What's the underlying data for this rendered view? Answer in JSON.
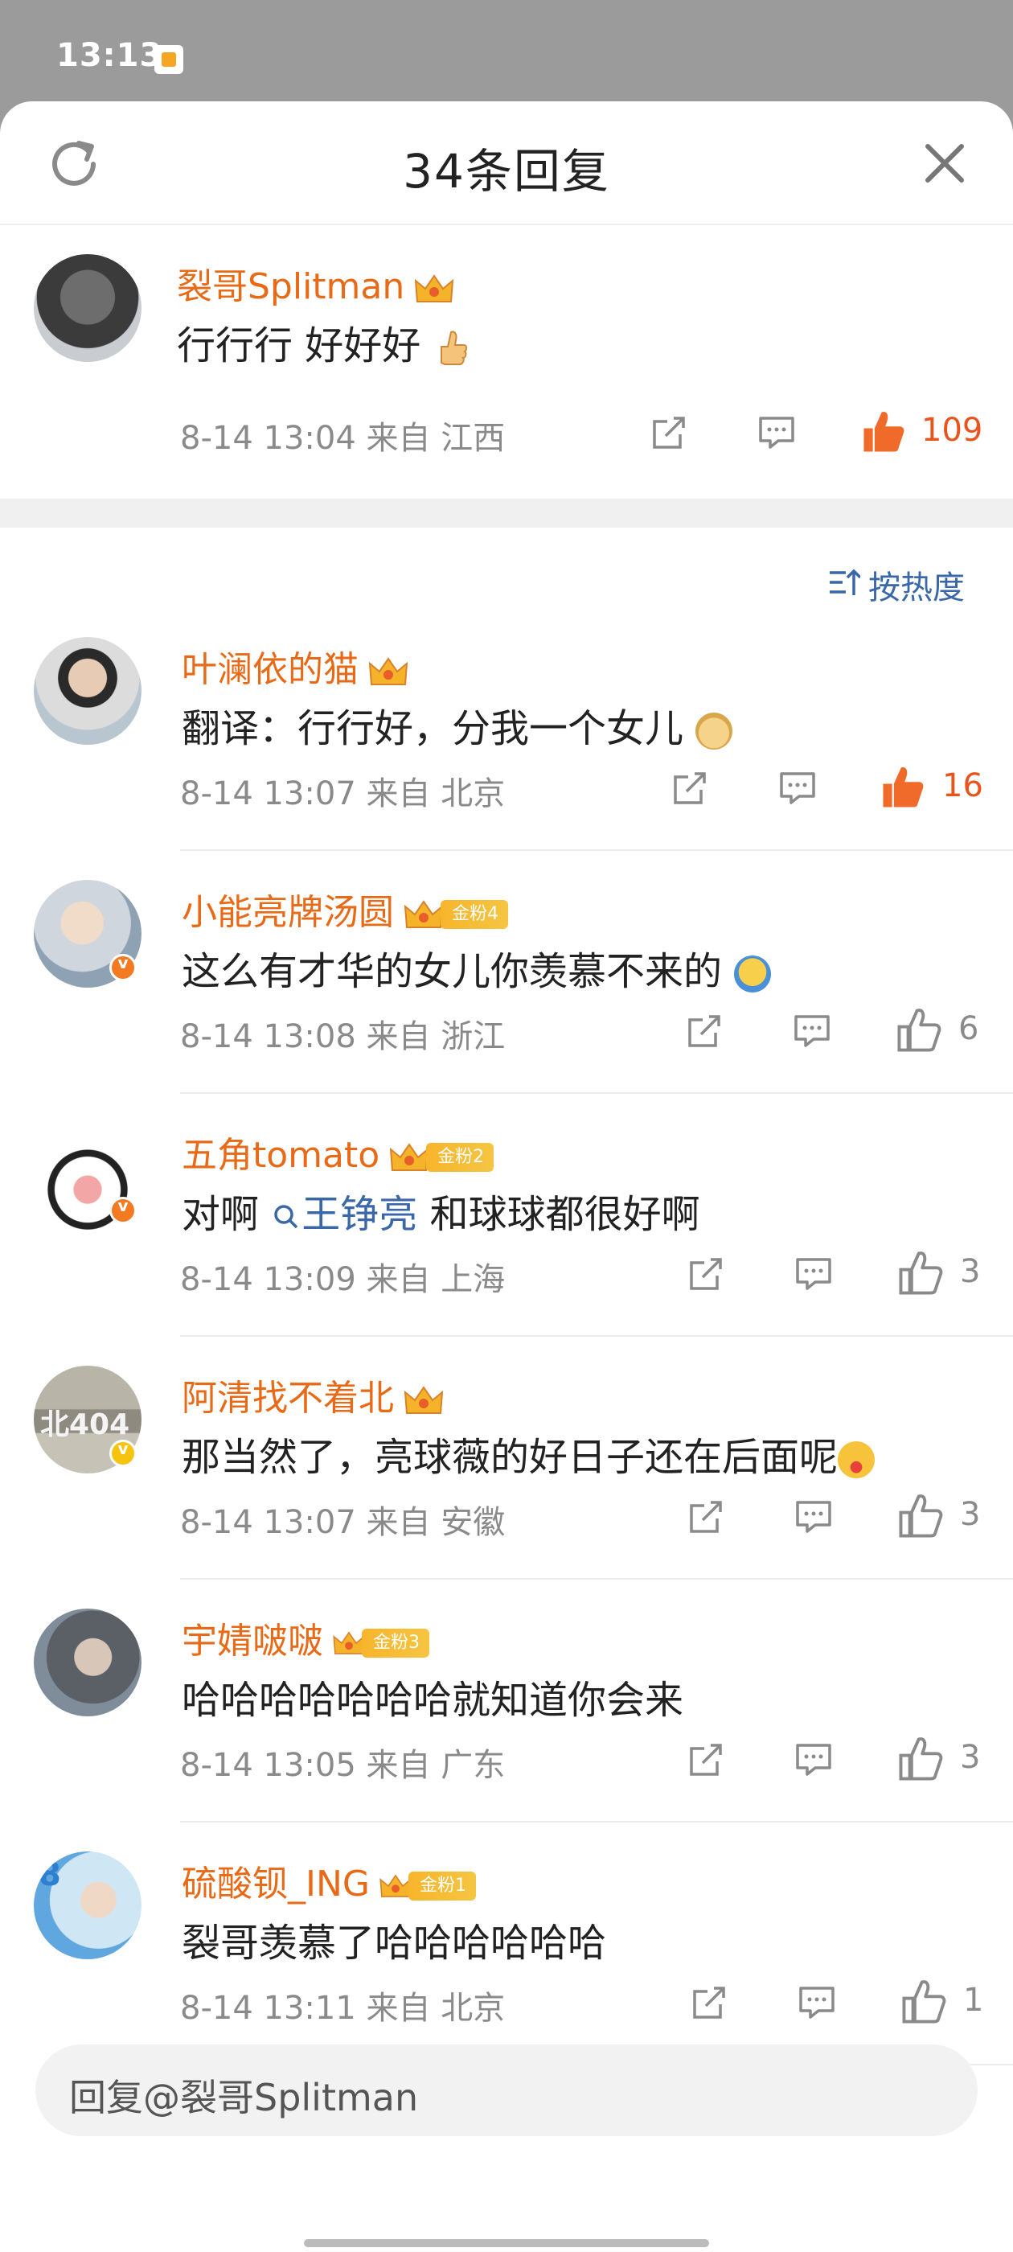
{
  "status_bar": {
    "time": "13:13"
  },
  "sheet": {
    "title": "34条回复"
  },
  "main_comment": {
    "username": "裂哥Splitman",
    "text": "行行行 好好好",
    "emoji": "thumbs-up",
    "meta": "8-14 13:04 来自 江西",
    "likes": "109",
    "liked": true
  },
  "sort": {
    "label": "按热度"
  },
  "replies": [
    {
      "username": "叶澜依的猫",
      "text": "翻译：行行好，分我一个女儿",
      "emoji": "doge",
      "fan_badge": "",
      "verified": "",
      "meta": "8-14 13:07 来自 北京",
      "likes": "16",
      "liked": true
    },
    {
      "username": "小能亮牌汤圆",
      "text": "这么有才华的女儿你羡慕不来的",
      "emoji": "shrug",
      "fan_badge": "金粉4",
      "verified": "orange",
      "meta": "8-14 13:08 来自 浙江",
      "likes": "6",
      "liked": false
    },
    {
      "username": "五角tomato",
      "text_before": "对啊",
      "mention": "王铮亮",
      "text_after": "和球球都很好啊",
      "fan_badge": "金粉2",
      "verified": "orange",
      "meta": "8-14 13:09 来自 上海",
      "likes": "3",
      "liked": false
    },
    {
      "username": "阿清找不着北",
      "text": "那当然了，亮球薇的好日子还在后面呢",
      "emoji": "tongue",
      "fan_badge": "",
      "verified": "yellow",
      "meta": "8-14 13:07 来自 安徽",
      "likes": "3",
      "liked": false
    },
    {
      "username": "宇婧啵啵",
      "text": "哈哈哈哈哈哈哈就知道你会来",
      "fan_badge": "金粉3",
      "verified": "",
      "meta": "8-14 13:05 来自 广东",
      "likes": "3",
      "liked": false
    },
    {
      "username": "硫酸钡_ING",
      "text": "裂哥羡慕了哈哈哈哈哈哈",
      "fan_badge": "金粉1",
      "verified": "",
      "meta": "8-14 13:11 来自 北京",
      "likes": "1",
      "liked": false
    }
  ],
  "reply_bar": {
    "placeholder": "回复@裂哥Splitman"
  },
  "colors": {
    "accent_orange": "#e86a17",
    "like_red": "#e8541c",
    "link_blue": "#3a67a8"
  }
}
